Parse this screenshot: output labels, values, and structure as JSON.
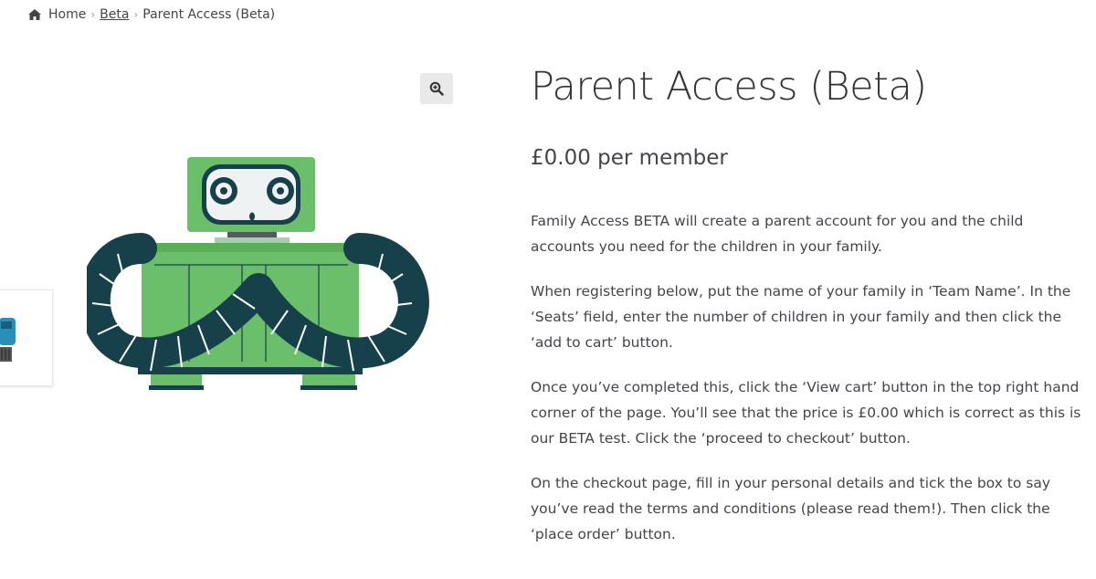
{
  "breadcrumb": {
    "home": "Home",
    "beta": "Beta",
    "current": "Parent Access (Beta)"
  },
  "product": {
    "title": "Parent Access (Beta)",
    "price": "£0.00 per member",
    "paragraphs": [
      "Family Access BETA will create a parent account for you and the child accounts you need for the children in your family.",
      "When registering below, put the name of your family in ‘Team Name’. In the ‘Seats’ field, enter the number of children in your family and then click the ‘add to cart’ button.",
      "Once you’ve completed this, click the ‘View cart’ button in the top right hand corner of the page. You’ll see that the price is £0.00 which is correct as this is our BETA test. Click the ‘proceed to checkout’ button.",
      "On the checkout page, fill in your personal details and tick the box to say you’ve read the terms and conditions (please read them!). Then click the ‘place order’ button."
    ]
  },
  "icons": {
    "home": "home-icon",
    "zoom": "zoom-in-icon",
    "separator": "chevron-right-icon"
  },
  "colors": {
    "robot_green": "#6cbf6a",
    "robot_dark": "#16404a",
    "text": "#43454b"
  }
}
